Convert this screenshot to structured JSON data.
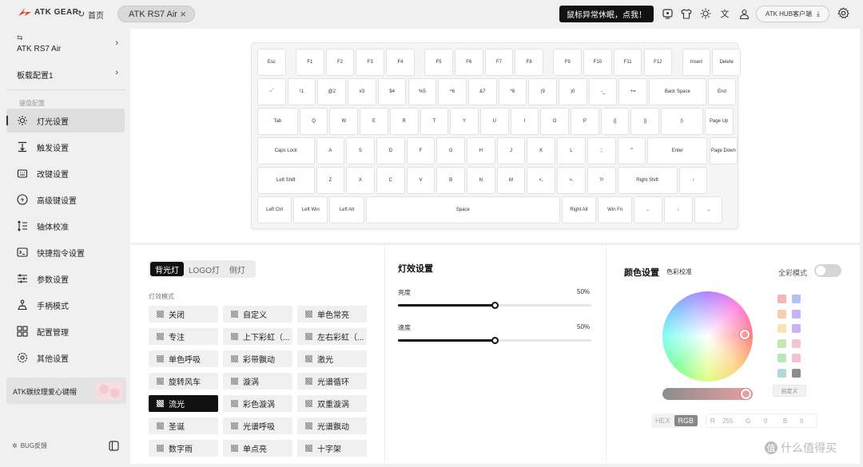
{
  "topbar": {
    "logo_text": "ATK GEAR",
    "home_label": "首页",
    "tab_label": "ATK RS7 Air",
    "notice_button": "鼠标异常休眠，点我！",
    "hub_button": "ATK HUB客户端"
  },
  "sidebar": {
    "device_small": "⇆",
    "device_name": "ATK RS7 Air",
    "profile": "板载配置1",
    "section_label": "键盘配置",
    "items": [
      {
        "label": "灯光设置",
        "icon": "bulb-icon"
      },
      {
        "label": "触发设置",
        "icon": "trigger-icon"
      },
      {
        "label": "改键设置",
        "icon": "remap-icon"
      },
      {
        "label": "高级键设置",
        "icon": "lightning-icon"
      },
      {
        "label": "轴体校准",
        "icon": "calibrate-icon"
      },
      {
        "label": "快捷指令设置",
        "icon": "terminal-icon"
      },
      {
        "label": "参数设置",
        "icon": "sliders-icon"
      },
      {
        "label": "手柄模式",
        "icon": "gamepad-icon"
      },
      {
        "label": "配置管理",
        "icon": "grid-icon"
      },
      {
        "label": "其他设置",
        "icon": "gear-icon"
      }
    ],
    "promo": "ATK碳纹理爱心键帽",
    "bug_label": "BUG反馈"
  },
  "keyboard": {
    "rows": [
      [
        "Esc",
        "F1",
        "F2",
        "F3",
        "F4",
        "F5",
        "F6",
        "F7",
        "F8",
        "F9",
        "F10",
        "F11",
        "F12",
        "Insert",
        "Delete"
      ],
      [
        "~`",
        "!1",
        "@2",
        "#3",
        "$4",
        "%5",
        "^6",
        "&7",
        "*8",
        "(9",
        ")0",
        "-_",
        "+=",
        "Back Space",
        "End"
      ],
      [
        "Tab",
        "Q",
        "W",
        "E",
        "R",
        "T",
        "Y",
        "U",
        "I",
        "O",
        "P",
        "{[",
        "}]",
        "|\\",
        "Page Up"
      ],
      [
        "Caps Lock",
        "A",
        "S",
        "D",
        "F",
        "G",
        "H",
        "J",
        "K",
        "L",
        ":;",
        "\"'",
        "Enter",
        "Page Down"
      ],
      [
        "Left Shift",
        "Z",
        "X",
        "C",
        "V",
        "B",
        "N",
        "M",
        "<,",
        ">.",
        "?/",
        "Right Shift",
        "↑"
      ],
      [
        "Left Ctrl",
        "Left Win",
        "Left Alt",
        "Space",
        "Right Alt",
        "Win Fn",
        "←",
        "↓",
        "→"
      ]
    ]
  },
  "effects": {
    "tabs": [
      "背光灯",
      "LOGO灯",
      "侧灯"
    ],
    "mode_label": "灯效模式",
    "active": "流光",
    "items": [
      "关闭",
      "自定义",
      "单色常亮",
      "专注",
      "上下彩虹（...",
      "左右彩虹（...",
      "单色呼吸",
      "彩带飘动",
      "激光",
      "旋转风车",
      "漩涡",
      "光谱循环",
      "流光",
      "彩色漩涡",
      "双重漩涡",
      "圣诞",
      "光谱呼吸",
      "光谱飘动",
      "数字雨",
      "单点亮",
      "十字架"
    ]
  },
  "light_settings": {
    "title": "灯效设置",
    "brightness_label": "亮度",
    "brightness_value": "50%",
    "brightness": 0.5,
    "speed_label": "速度",
    "speed_value": "50%",
    "speed": 0.5
  },
  "color": {
    "title": "颜色设置",
    "calibrate": "色彩校准",
    "full_mode_label": "全彩模式",
    "full_mode_on": false,
    "swatches": [
      "#f4b5b5",
      "#b5c3f4",
      "#f4cfb0",
      "#c4b5f4",
      "#f4e8b0",
      "#cbb0f4",
      "#c9e6b0",
      "#f4c6d2",
      "#b9e8b9",
      "#f4c2cf",
      "#b0dad6",
      "#8c8c8c"
    ],
    "custom_label": "自定义",
    "format_hex": "HEX",
    "format_rgb": "RGB",
    "r_label": "R",
    "r_value": "255",
    "g_label": "G",
    "g_value": "0",
    "b_label": "B",
    "b_value": "0"
  },
  "watermark": "什么值得买"
}
